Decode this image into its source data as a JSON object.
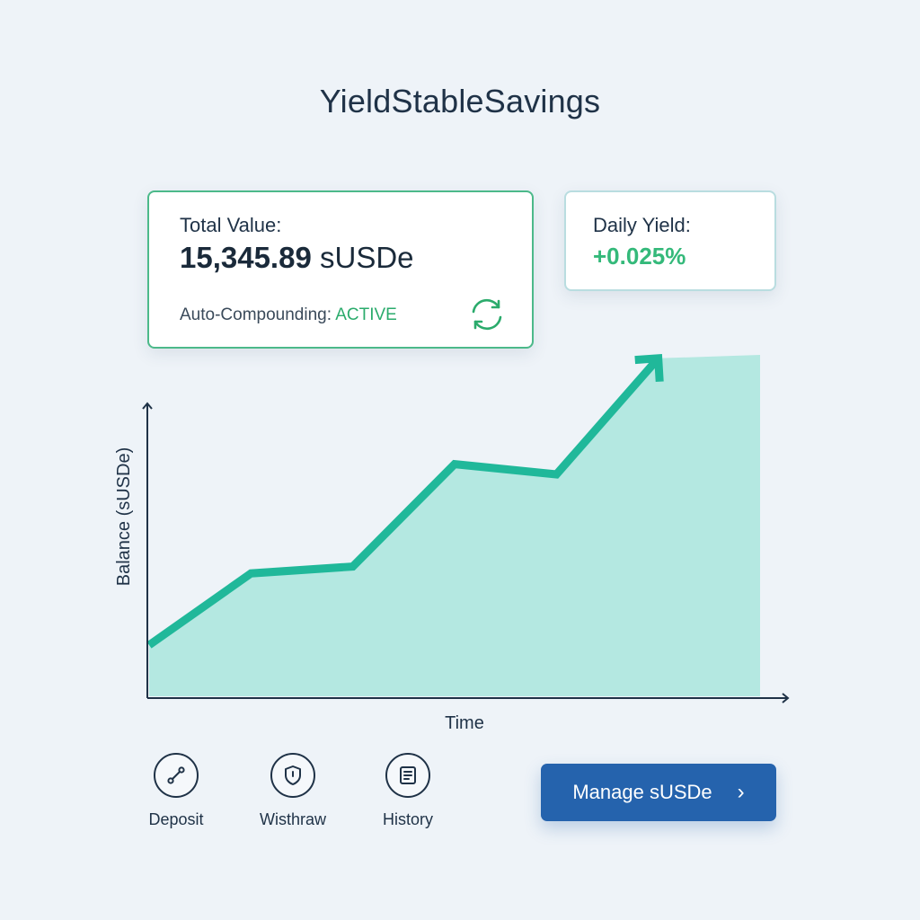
{
  "app": {
    "title": "YieldStableSavings"
  },
  "total_card": {
    "label": "Total Value:",
    "amount": "15,345.89",
    "unit": "sUSDe",
    "compound_label": "Auto-Compounding:",
    "compound_status": "ACTIVE",
    "icon": "refresh-icon"
  },
  "yield_card": {
    "label": "Daily Yield:",
    "value": "+0.025%"
  },
  "chart_data": {
    "type": "area",
    "xlabel": "Time",
    "ylabel": "Balance (sUSDe)",
    "x": [
      0,
      1,
      2,
      3,
      4,
      5,
      6
    ],
    "values": [
      0.15,
      0.36,
      0.38,
      0.68,
      0.65,
      0.99,
      1.0
    ],
    "ylim": [
      0,
      1
    ],
    "grid": false,
    "colors": {
      "line": "#20b89a",
      "fill": "#b4e8e1",
      "axis": "#1f3247"
    },
    "trend_arrow": true
  },
  "actions": [
    {
      "label": "Deposit",
      "icon": "deposit-icon"
    },
    {
      "label": "Wisthraw",
      "icon": "shield-icon"
    },
    {
      "label": "History",
      "icon": "document-icon"
    }
  ],
  "manage": {
    "label": "Manage sUSDe",
    "icon": "chevron-right-icon"
  },
  "colors": {
    "background": "#eef3f8",
    "accent_green": "#34b97a",
    "button_blue": "#2563ad",
    "text_dark": "#1f3247"
  }
}
